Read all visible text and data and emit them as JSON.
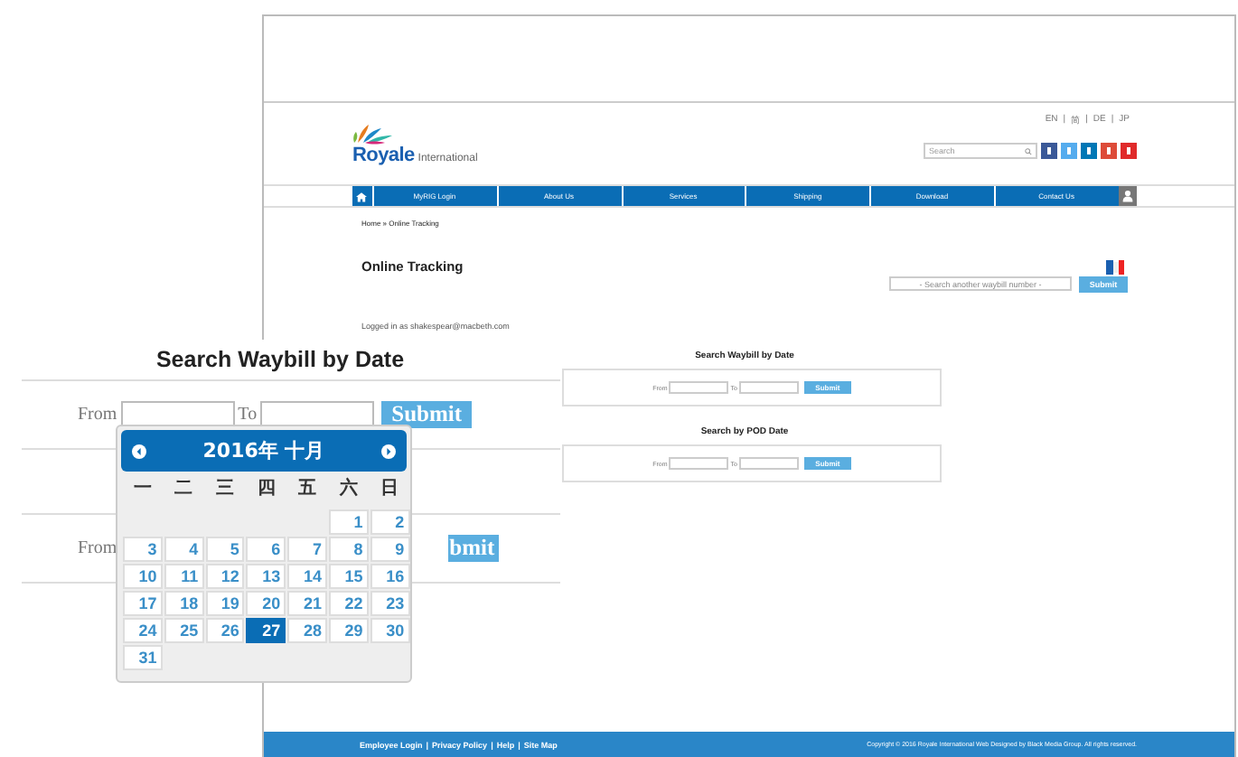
{
  "lang_links": [
    "EN",
    "简",
    "DE",
    "JP"
  ],
  "lang_separator": "|",
  "logo": {
    "name": "Royale",
    "suffix": "International"
  },
  "site_search": {
    "placeholder": "Search"
  },
  "nav": [
    {
      "label": "MyRIG Login"
    },
    {
      "label": "About Us"
    },
    {
      "label": "Services"
    },
    {
      "label": "Shipping"
    },
    {
      "label": "Download"
    },
    {
      "label": "Contact Us"
    }
  ],
  "breadcrumb": "Home » Online Tracking",
  "title": "Online Tracking",
  "waybill_search": {
    "placeholder": "- Search another waybill number -",
    "button": "Submit"
  },
  "logged_in": "Logged in as shakespear@macbeth.com",
  "sections": [
    {
      "title": "Search Waybill by Date",
      "from": "From",
      "to": "To",
      "button": "Submit"
    },
    {
      "title": "Search by POD Date",
      "from": "From",
      "to": "To",
      "button": "Submit"
    }
  ],
  "footer": {
    "links": [
      "Employee Login",
      "Privacy Policy",
      "Help",
      "Site Map"
    ],
    "separator": "|",
    "copyright": "Copyright © 2016 Royale International Web Designed by Black Media Group. All rights reserved."
  },
  "zoom_panel": {
    "title": "Search Waybill by Date",
    "rows": [
      {
        "from": "From",
        "to": "To",
        "button": "Submit"
      },
      {
        "from": "From",
        "button": "bmit"
      }
    ],
    "calendar": {
      "title": "2016年 十月",
      "weekdays": [
        "一",
        "二",
        "三",
        "四",
        "五",
        "六",
        "日"
      ],
      "weeks": [
        [
          {
            "day": "1",
            "selected": false
          },
          {
            "day": "2",
            "selected": false
          }
        ],
        [
          {
            "day": "3",
            "selected": false
          },
          {
            "day": "4",
            "selected": false
          },
          {
            "day": "5",
            "selected": false
          },
          {
            "day": "6",
            "selected": false
          },
          {
            "day": "7",
            "selected": false
          },
          {
            "day": "8",
            "selected": false
          },
          {
            "day": "9",
            "selected": false
          }
        ],
        [
          {
            "day": "10",
            "selected": false
          },
          {
            "day": "11",
            "selected": false
          },
          {
            "day": "12",
            "selected": false
          },
          {
            "day": "13",
            "selected": false
          },
          {
            "day": "14",
            "selected": false
          },
          {
            "day": "15",
            "selected": false
          },
          {
            "day": "16",
            "selected": false
          }
        ],
        [
          {
            "day": "17",
            "selected": false
          },
          {
            "day": "18",
            "selected": false
          },
          {
            "day": "19",
            "selected": false
          },
          {
            "day": "20",
            "selected": false
          },
          {
            "day": "21",
            "selected": false
          },
          {
            "day": "22",
            "selected": false
          },
          {
            "day": "23",
            "selected": false
          }
        ],
        [
          {
            "day": "24",
            "selected": false
          },
          {
            "day": "25",
            "selected": false
          },
          {
            "day": "26",
            "selected": false
          },
          {
            "day": "27",
            "selected": true
          },
          {
            "day": "28",
            "selected": false
          },
          {
            "day": "29",
            "selected": false
          },
          {
            "day": "30",
            "selected": false
          }
        ],
        [
          {
            "day": "31",
            "selected": false
          }
        ]
      ]
    }
  }
}
